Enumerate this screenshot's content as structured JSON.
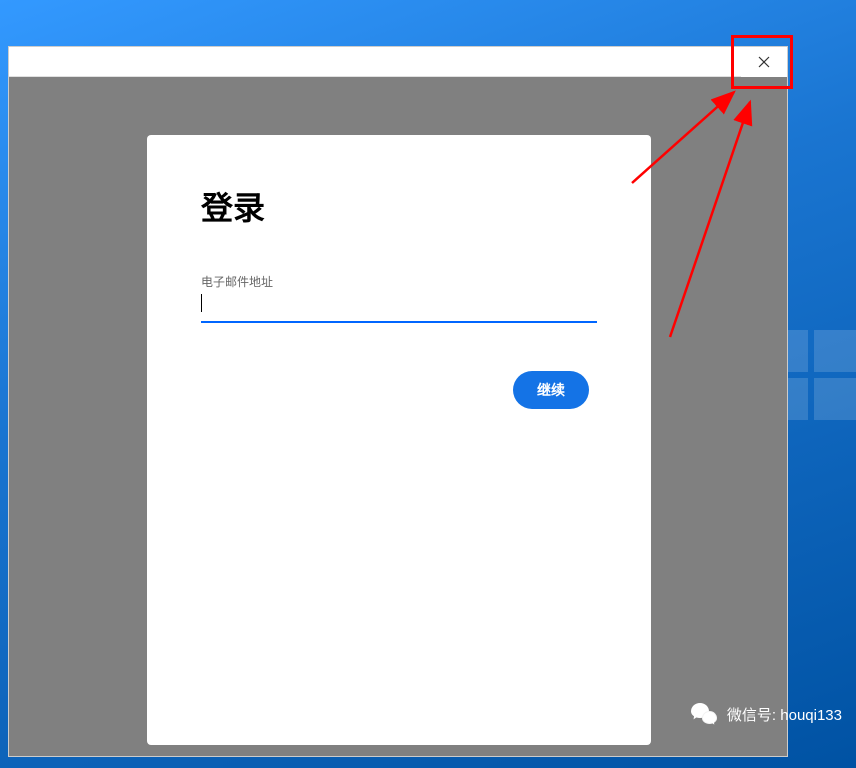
{
  "login": {
    "title": "登录",
    "email_label": "电子邮件地址",
    "email_value": "",
    "continue_label": "继续"
  },
  "annotation": {
    "highlight_color": "#ff0000"
  },
  "watermark": {
    "label_prefix": "微信号: ",
    "account": "houqi133"
  }
}
